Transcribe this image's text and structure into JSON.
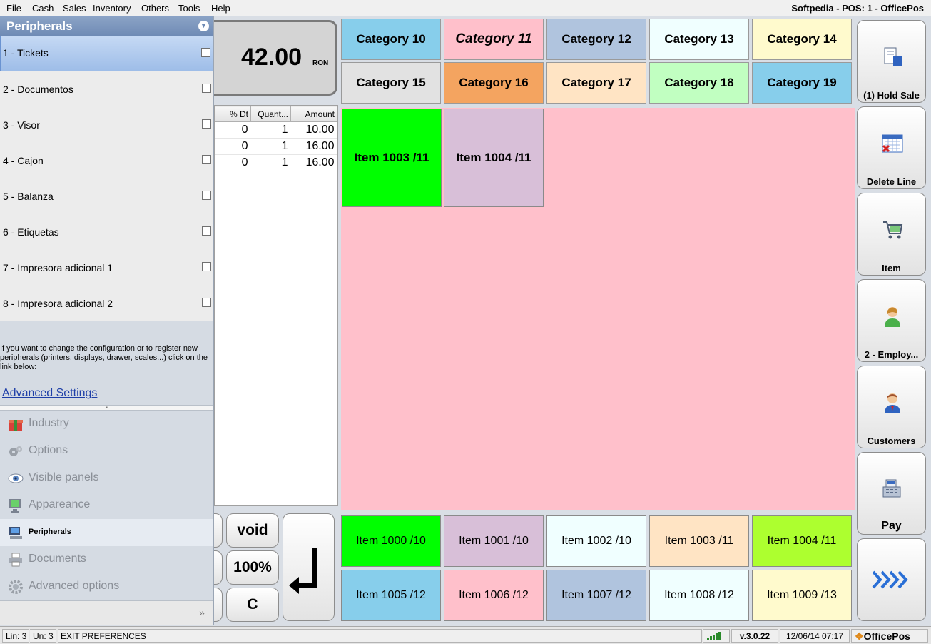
{
  "menu": [
    "File",
    "Cash",
    "Sales",
    "Inventory",
    "Others",
    "Tools",
    "Help"
  ],
  "window_title": "Softpedia - POS: 1 - OfficePos",
  "left_panel": {
    "title": "Peripherals",
    "items": [
      {
        "label": "1 - Tickets"
      },
      {
        "label": "2 - Documentos"
      },
      {
        "label": "3 - Visor"
      },
      {
        "label": "4 - Cajon"
      },
      {
        "label": "5 - Balanza"
      },
      {
        "label": "6 - Etiquetas"
      },
      {
        "label": "7 - Impresora adicional 1"
      },
      {
        "label": "8 - Impresora adicional 2"
      }
    ],
    "info": "If you want to change the configuration or to register new peripherals (printers, displays, drawer, scales...) click on the link below:",
    "link": "Advanced Settings",
    "nav": [
      {
        "label": "Industry",
        "icon": "gift-icon"
      },
      {
        "label": "Options",
        "icon": "gears-icon"
      },
      {
        "label": "Visible panels",
        "icon": "eye-icon"
      },
      {
        "label": "Appareance",
        "icon": "monitor-icon"
      },
      {
        "label": "Peripherals",
        "icon": "computer-icon"
      },
      {
        "label": "Documents",
        "icon": "printer-icon"
      },
      {
        "label": "Advanced options",
        "icon": "gear-icon"
      }
    ],
    "more": "»"
  },
  "total": {
    "value": "42.00",
    "currency": "RON"
  },
  "ticket": {
    "headers": [
      "% Dt",
      "Quant...",
      "Amount"
    ],
    "rows": [
      [
        "0",
        "1",
        "10.00"
      ],
      [
        "0",
        "1",
        "16.00"
      ],
      [
        "0",
        "1",
        "16.00"
      ]
    ]
  },
  "keypad": {
    "void": "void",
    "percent": "100%",
    "clear": "C"
  },
  "categories": [
    {
      "label": "Category 10",
      "color": "#87ceeb"
    },
    {
      "label": "Category 11",
      "color": "#ffc0cb"
    },
    {
      "label": "Category 12",
      "color": "#b0c4de"
    },
    {
      "label": "Category 13",
      "color": "#f0ffff"
    },
    {
      "label": "Category 14",
      "color": "#fffacd"
    },
    {
      "label": "Category 15",
      "color": "#e2e2e2"
    },
    {
      "label": "Category 16",
      "color": "#f4a460"
    },
    {
      "label": "Category 17",
      "color": "#ffe4c4"
    },
    {
      "label": "Category 18",
      "color": "#c1ffc1"
    },
    {
      "label": "Category 19",
      "color": "#87ceeb"
    }
  ],
  "category_items": [
    {
      "label": "Item 1003 /11",
      "color": "#00ff00"
    },
    {
      "label": "Item 1004 /11",
      "color": "#d8bfd8"
    }
  ],
  "bottom_items": [
    {
      "label": "Item 1000 /10",
      "color": "#00ff00"
    },
    {
      "label": "Item 1001 /10",
      "color": "#d8bfd8"
    },
    {
      "label": "Item 1002 /10",
      "color": "#f0ffff"
    },
    {
      "label": "Item 1003 /11",
      "color": "#ffe4c4"
    },
    {
      "label": "Item 1004 /11",
      "color": "#adff2f"
    },
    {
      "label": "Item 1005 /12",
      "color": "#87ceeb"
    },
    {
      "label": "Item 1006 /12",
      "color": "#ffc0cb"
    },
    {
      "label": "Item 1007 /12",
      "color": "#b0c4de"
    },
    {
      "label": "Item 1008 /12",
      "color": "#f0ffff"
    },
    {
      "label": "Item 1009 /13",
      "color": "#fffacd"
    }
  ],
  "actions": [
    {
      "label": "(1) Hold Sale",
      "icon": "hold-sale-icon"
    },
    {
      "label": "Delete Line",
      "icon": "calendar-delete-icon"
    },
    {
      "label": "Item",
      "icon": "cart-icon"
    },
    {
      "label": "2 - Employ...",
      "icon": "employee-icon"
    },
    {
      "label": "Customers",
      "icon": "customer-icon"
    },
    {
      "label": "Pay",
      "icon": "cash-register-icon"
    },
    {
      "label": "",
      "icon": "next-arrows-icon"
    }
  ],
  "status": {
    "lin": "Lin: 3",
    "un": "Un: 3",
    "message": "EXIT PREFERENCES",
    "version": "v.3.0.22",
    "datetime": "12/06/14 07:17",
    "brand": "OfficePos"
  }
}
